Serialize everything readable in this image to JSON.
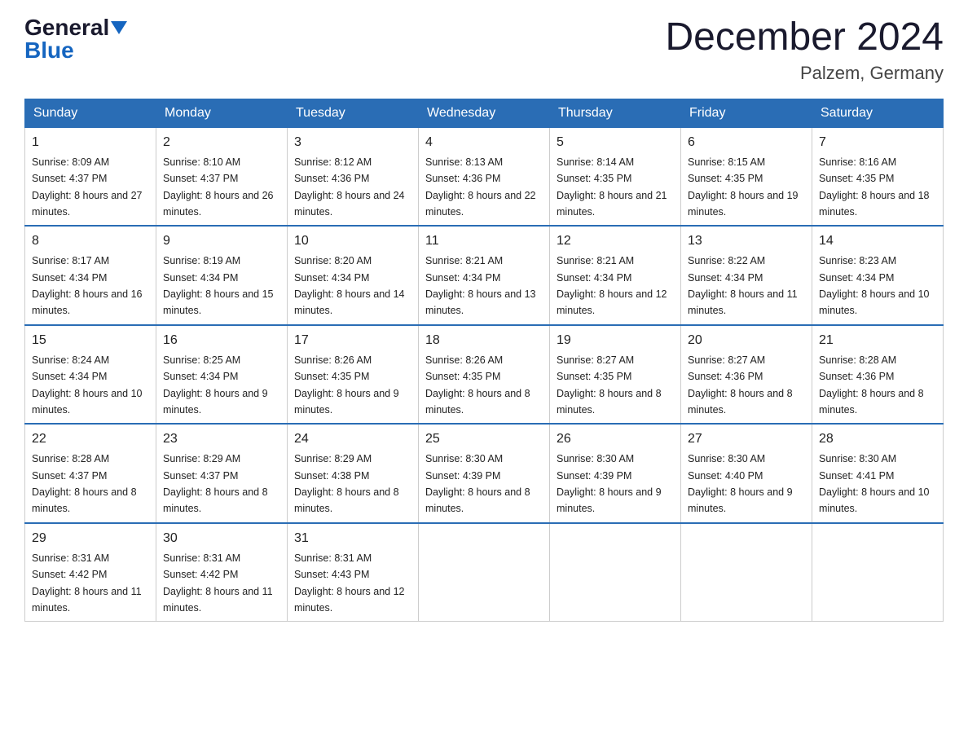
{
  "header": {
    "logo_general": "General",
    "logo_blue": "Blue",
    "title": "December 2024",
    "location": "Palzem, Germany"
  },
  "days_of_week": [
    "Sunday",
    "Monday",
    "Tuesday",
    "Wednesday",
    "Thursday",
    "Friday",
    "Saturday"
  ],
  "weeks": [
    [
      {
        "day": "1",
        "sunrise": "8:09 AM",
        "sunset": "4:37 PM",
        "daylight": "8 hours and 27 minutes."
      },
      {
        "day": "2",
        "sunrise": "8:10 AM",
        "sunset": "4:37 PM",
        "daylight": "8 hours and 26 minutes."
      },
      {
        "day": "3",
        "sunrise": "8:12 AM",
        "sunset": "4:36 PM",
        "daylight": "8 hours and 24 minutes."
      },
      {
        "day": "4",
        "sunrise": "8:13 AM",
        "sunset": "4:36 PM",
        "daylight": "8 hours and 22 minutes."
      },
      {
        "day": "5",
        "sunrise": "8:14 AM",
        "sunset": "4:35 PM",
        "daylight": "8 hours and 21 minutes."
      },
      {
        "day": "6",
        "sunrise": "8:15 AM",
        "sunset": "4:35 PM",
        "daylight": "8 hours and 19 minutes."
      },
      {
        "day": "7",
        "sunrise": "8:16 AM",
        "sunset": "4:35 PM",
        "daylight": "8 hours and 18 minutes."
      }
    ],
    [
      {
        "day": "8",
        "sunrise": "8:17 AM",
        "sunset": "4:34 PM",
        "daylight": "8 hours and 16 minutes."
      },
      {
        "day": "9",
        "sunrise": "8:19 AM",
        "sunset": "4:34 PM",
        "daylight": "8 hours and 15 minutes."
      },
      {
        "day": "10",
        "sunrise": "8:20 AM",
        "sunset": "4:34 PM",
        "daylight": "8 hours and 14 minutes."
      },
      {
        "day": "11",
        "sunrise": "8:21 AM",
        "sunset": "4:34 PM",
        "daylight": "8 hours and 13 minutes."
      },
      {
        "day": "12",
        "sunrise": "8:21 AM",
        "sunset": "4:34 PM",
        "daylight": "8 hours and 12 minutes."
      },
      {
        "day": "13",
        "sunrise": "8:22 AM",
        "sunset": "4:34 PM",
        "daylight": "8 hours and 11 minutes."
      },
      {
        "day": "14",
        "sunrise": "8:23 AM",
        "sunset": "4:34 PM",
        "daylight": "8 hours and 10 minutes."
      }
    ],
    [
      {
        "day": "15",
        "sunrise": "8:24 AM",
        "sunset": "4:34 PM",
        "daylight": "8 hours and 10 minutes."
      },
      {
        "day": "16",
        "sunrise": "8:25 AM",
        "sunset": "4:34 PM",
        "daylight": "8 hours and 9 minutes."
      },
      {
        "day": "17",
        "sunrise": "8:26 AM",
        "sunset": "4:35 PM",
        "daylight": "8 hours and 9 minutes."
      },
      {
        "day": "18",
        "sunrise": "8:26 AM",
        "sunset": "4:35 PM",
        "daylight": "8 hours and 8 minutes."
      },
      {
        "day": "19",
        "sunrise": "8:27 AM",
        "sunset": "4:35 PM",
        "daylight": "8 hours and 8 minutes."
      },
      {
        "day": "20",
        "sunrise": "8:27 AM",
        "sunset": "4:36 PM",
        "daylight": "8 hours and 8 minutes."
      },
      {
        "day": "21",
        "sunrise": "8:28 AM",
        "sunset": "4:36 PM",
        "daylight": "8 hours and 8 minutes."
      }
    ],
    [
      {
        "day": "22",
        "sunrise": "8:28 AM",
        "sunset": "4:37 PM",
        "daylight": "8 hours and 8 minutes."
      },
      {
        "day": "23",
        "sunrise": "8:29 AM",
        "sunset": "4:37 PM",
        "daylight": "8 hours and 8 minutes."
      },
      {
        "day": "24",
        "sunrise": "8:29 AM",
        "sunset": "4:38 PM",
        "daylight": "8 hours and 8 minutes."
      },
      {
        "day": "25",
        "sunrise": "8:30 AM",
        "sunset": "4:39 PM",
        "daylight": "8 hours and 8 minutes."
      },
      {
        "day": "26",
        "sunrise": "8:30 AM",
        "sunset": "4:39 PM",
        "daylight": "8 hours and 9 minutes."
      },
      {
        "day": "27",
        "sunrise": "8:30 AM",
        "sunset": "4:40 PM",
        "daylight": "8 hours and 9 minutes."
      },
      {
        "day": "28",
        "sunrise": "8:30 AM",
        "sunset": "4:41 PM",
        "daylight": "8 hours and 10 minutes."
      }
    ],
    [
      {
        "day": "29",
        "sunrise": "8:31 AM",
        "sunset": "4:42 PM",
        "daylight": "8 hours and 11 minutes."
      },
      {
        "day": "30",
        "sunrise": "8:31 AM",
        "sunset": "4:42 PM",
        "daylight": "8 hours and 11 minutes."
      },
      {
        "day": "31",
        "sunrise": "8:31 AM",
        "sunset": "4:43 PM",
        "daylight": "8 hours and 12 minutes."
      },
      null,
      null,
      null,
      null
    ]
  ]
}
